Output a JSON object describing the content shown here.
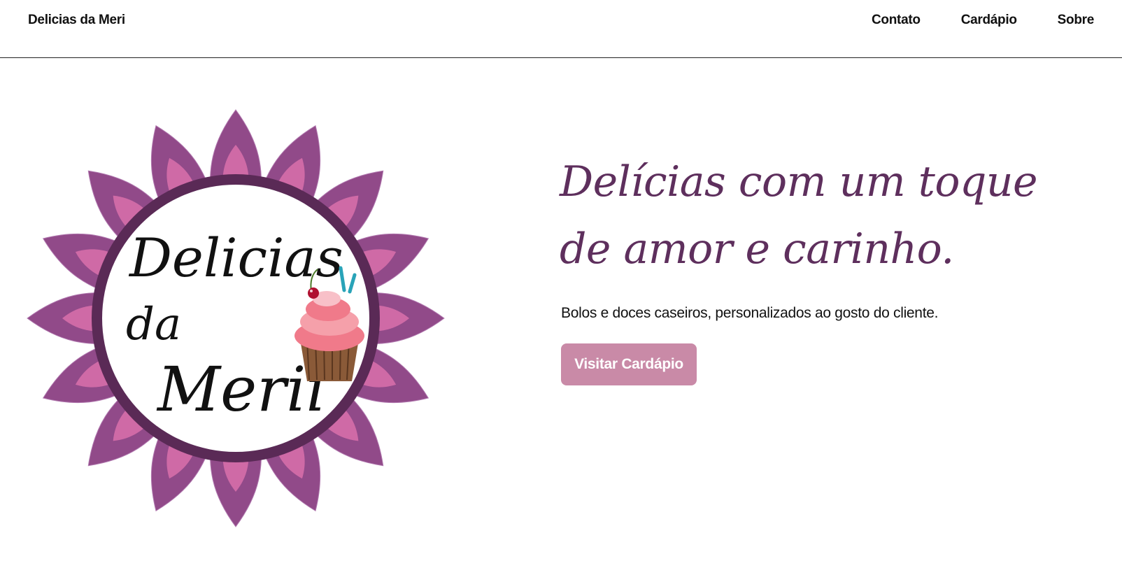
{
  "nav": {
    "brand": "Delicias da Meri",
    "links": [
      "Contato",
      "Cardápio",
      "Sobre"
    ]
  },
  "hero": {
    "headline": "Delícias com um toque de amor e carinho.",
    "subtitle": "Bolos e doces caseiros, personalizados ao gosto do cliente.",
    "cta_label": "Visitar Cardápio",
    "logo": {
      "line1": "Delicias",
      "line2": "da",
      "line3": "Merii",
      "icon": "cupcake-icon"
    }
  },
  "colors": {
    "headline": "#5e2f5d",
    "cta_background": "#c98aa7",
    "petal_outer": "#914a89",
    "petal_inner": "#cf6aa6",
    "logo_ring": "#5a2a56"
  }
}
